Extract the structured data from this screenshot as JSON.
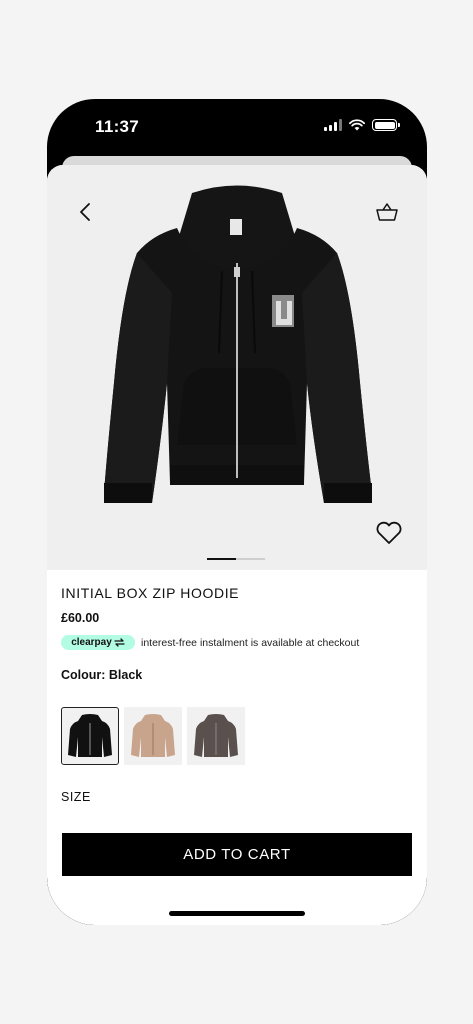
{
  "status_bar": {
    "time": "11:37"
  },
  "product": {
    "name": "INITIAL BOX ZIP HOODIE",
    "price": "£60.00",
    "clearpay": {
      "badge": "clearpay",
      "text": "interest-free instalment is available at checkout"
    },
    "colour_label": "Colour: Black",
    "colours": [
      {
        "name": "Black",
        "hex": "#111111",
        "selected": true
      },
      {
        "name": "Tan",
        "hex": "#c8a48c",
        "selected": false
      },
      {
        "name": "Brown",
        "hex": "#5a514e",
        "selected": false
      }
    ],
    "size_label": "SIZE"
  },
  "gallery": {
    "total_images": 2,
    "current_image": 1
  },
  "actions": {
    "add_to_cart": "ADD TO CART"
  },
  "icons": {
    "back": "chevron-left-icon",
    "basket": "basket-icon",
    "wishlist": "heart-icon"
  }
}
